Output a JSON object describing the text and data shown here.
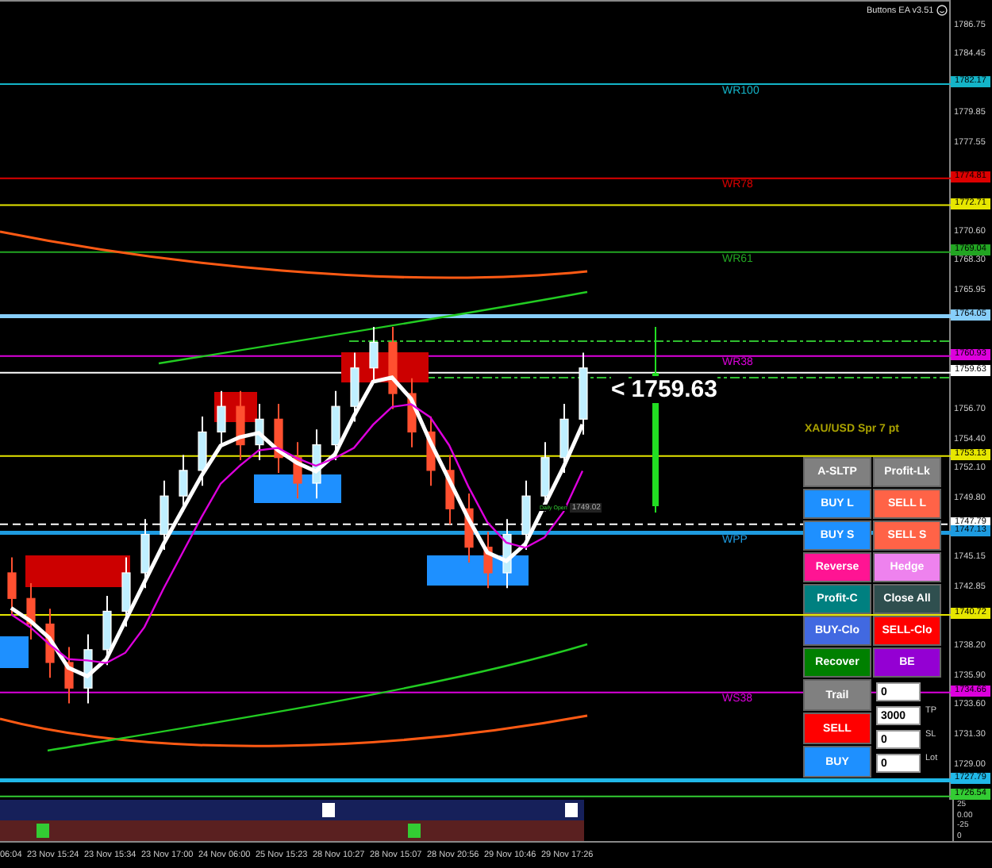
{
  "ea_label": {
    "title": "Buttons EA v3.51"
  },
  "levels": [
    {
      "label": "WR100",
      "tag": "1782.17",
      "color": "#14b4c8"
    },
    {
      "label": "WR78",
      "tag": "1774.81",
      "color": "#dd0000"
    },
    {
      "tag": "1772.71",
      "color": "#e6e600"
    },
    {
      "label": "WR61",
      "tag": "1769.04",
      "color": "#22a522"
    },
    {
      "tag": "1764.05",
      "color": "#87cefa"
    },
    {
      "label": "WR38",
      "tag": "1760.93",
      "color": "#dd00dd"
    },
    {
      "tag": "1759.63",
      "color": "#ffffff"
    },
    {
      "tag": "1753.13",
      "color": "#e6e600"
    },
    {
      "tag": "1747.79",
      "color": "#ffffff"
    },
    {
      "label": "WPP",
      "tag": "1747.13",
      "color": "#1e9be0"
    },
    {
      "tag": "1740.72",
      "color": "#e6e600"
    },
    {
      "label": "WS38",
      "tag": "1734.66",
      "color": "#dd00dd"
    },
    {
      "tag": "1727.79",
      "color": "#20b8e8"
    },
    {
      "tag": "1726.54",
      "color": "#33cc33"
    }
  ],
  "price_axis": {
    "ticks": [
      "1786.75",
      "1784.45",
      "1779.85",
      "1777.55",
      "1770.60",
      "1768.30",
      "1765.95",
      "1756.70",
      "1754.40",
      "1752.10",
      "1749.80",
      "1745.15",
      "1742.85",
      "1738.20",
      "1735.90",
      "1733.60",
      "1731.30",
      "1729.00"
    ]
  },
  "current_price": {
    "arrow": "<",
    "value": "1759.63"
  },
  "daily_open": {
    "label": "Daily Open",
    "value": "1749.02"
  },
  "spread_label": "XAU/USD Spr 7 pt",
  "buttons": [
    {
      "label": "A-SLTP",
      "color": "#808080"
    },
    {
      "label": "Profit-Lk",
      "color": "#808080"
    },
    {
      "label": "BUY L",
      "color": "#1e90ff"
    },
    {
      "label": "SELL L",
      "color": "#ff6347"
    },
    {
      "label": "BUY S",
      "color": "#1e90ff"
    },
    {
      "label": "SELL S",
      "color": "#ff6347"
    },
    {
      "label": "Reverse",
      "color": "#ff1493"
    },
    {
      "label": "Hedge",
      "color": "#ee82ee"
    },
    {
      "label": "Profit-C",
      "color": "#008080"
    },
    {
      "label": "Close All",
      "color": "#2f4f4f"
    },
    {
      "label": "BUY-Clo",
      "color": "#4169e1"
    },
    {
      "label": "SELL-Clo",
      "color": "#ff0000"
    },
    {
      "label": "Recover",
      "color": "#008000"
    },
    {
      "label": "BE",
      "color": "#9400d3"
    }
  ],
  "side_buttons": [
    {
      "label": "Trail",
      "color": "#808080"
    },
    {
      "label": "SELL",
      "color": "#ff0000"
    },
    {
      "label": "BUY",
      "color": "#1e90ff"
    }
  ],
  "fields": [
    {
      "value": "0"
    },
    {
      "value": "3000",
      "label": "TP"
    },
    {
      "value": "0",
      "label": "SL"
    },
    {
      "value": "0",
      "label": "Lot"
    }
  ],
  "sub_axis": [
    "25",
    "0.00",
    "-25",
    "0"
  ],
  "time_axis": [
    "06:04",
    "23 Nov 15:24",
    "23 Nov 15:34",
    "23 Nov 17:00",
    "24 Nov 06:00",
    "25 Nov 15:23",
    "28 Nov 10:27",
    "28 Nov 15:07",
    "28 Nov 20:56",
    "29 Nov 10:46",
    "29 Nov 17:26"
  ]
}
